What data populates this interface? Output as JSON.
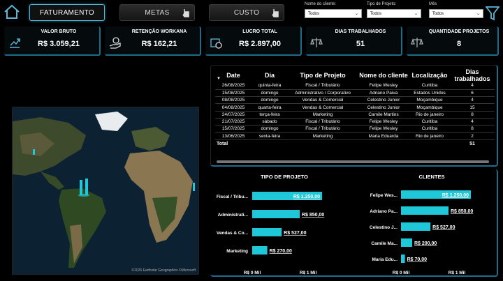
{
  "nav": {
    "buttons": [
      {
        "label": "FATURAMENTO",
        "active": true
      },
      {
        "label": "METAS",
        "active": false
      },
      {
        "label": "CUSTO",
        "active": false
      }
    ]
  },
  "filters": [
    {
      "label": "Nome do cliente:",
      "value": "Todos"
    },
    {
      "label": "Tipo de Projeto:",
      "value": "Todos"
    },
    {
      "label": "Mês",
      "value": "Todos"
    }
  ],
  "kpis": [
    {
      "title": "VALOR BRUTO",
      "value": "R$ 3.059,21",
      "icon": "trend-up-icon"
    },
    {
      "title": "RETENÇÃO WORKANA",
      "value": "R$ 162,21",
      "icon": "money-hand-icon"
    },
    {
      "title": "LUCRO TOTAL",
      "value": "R$ 2.897,00",
      "icon": "cash-register-icon"
    },
    {
      "title": "DIAS TRABALHADOS",
      "value": "51",
      "icon": "scale-icon"
    },
    {
      "title": "QUANTIDADE PROJETOS",
      "value": "8",
      "icon": "scale-icon"
    }
  ],
  "map": {
    "credit": "©2025 Earthstar Geographics  ©Microsoft"
  },
  "table": {
    "columns": [
      "Date",
      "Dia",
      "Tipo de Projeto",
      "Nome do cliente",
      "Localização",
      "Dias trabalhados"
    ],
    "rows": [
      [
        "26/08/2025",
        "quinta-feira",
        "Fiscal / Tributário",
        "Felipe Wesley",
        "Curitiba",
        "4"
      ],
      [
        "15/08/2025",
        "domingo",
        "Administrativo / Corporativo",
        "Adriano Paiva",
        "Estados Unidos",
        "6"
      ],
      [
        "08/08/2025",
        "domingo",
        "Vendas & Comercial",
        "Celestino Junior",
        "Moçambique",
        "4"
      ],
      [
        "04/08/2025",
        "quarta-feira",
        "Vendas & Comercial",
        "Celestino Junior",
        "Moçambique",
        "15"
      ],
      [
        "24/07/2025",
        "terça-feira",
        "Marketing",
        "Camile Martins",
        "Rio de janeiro",
        "8"
      ],
      [
        "21/07/2025",
        "sábado",
        "Fiscal / Tributário",
        "Felipe Wesley",
        "Curitiba",
        "4"
      ],
      [
        "15/07/2025",
        "domingo",
        "Fiscal / Tributário",
        "Felipe Wesley",
        "Curitiba",
        "8"
      ],
      [
        "13/06/2025",
        "sexta-feira",
        "Marketing",
        "Maria Eduarda",
        "Rio de janeiro",
        "2"
      ]
    ],
    "total": {
      "label": "Total",
      "value": "51"
    }
  },
  "chart_data": [
    {
      "type": "bar",
      "title": "TIPO DE PROJETO",
      "categories": [
        "Fiscal / Tribu...",
        "Administrati...",
        "Vendas & Co...",
        "Marketing"
      ],
      "values": [
        1250,
        850,
        527,
        270
      ],
      "value_labels": [
        "R$ 1.250,00",
        "R$ 850,00",
        "R$ 527,00",
        "R$ 270,00"
      ],
      "x_ticks": [
        "R$ 0 Mil",
        "R$ 1 Mil"
      ],
      "xlim": [
        0,
        1000
      ],
      "color": "#1ec8d8"
    },
    {
      "type": "bar",
      "title": "CLIENTES",
      "categories": [
        "Felipe Wes...",
        "Adriano Pa...",
        "Celestino J...",
        "Camile Ma...",
        "Maria Edu..."
      ],
      "values": [
        1250,
        850,
        527,
        200,
        70
      ],
      "value_labels": [
        "R$ 1.250,00",
        "R$ 850,00",
        "R$ 527,00",
        "R$ 200,00",
        "R$ 70,00"
      ],
      "x_ticks": [
        "R$ 0 Mil",
        "R$ 1 Mil"
      ],
      "xlim": [
        0,
        1000
      ],
      "color": "#1ec8d8"
    }
  ]
}
